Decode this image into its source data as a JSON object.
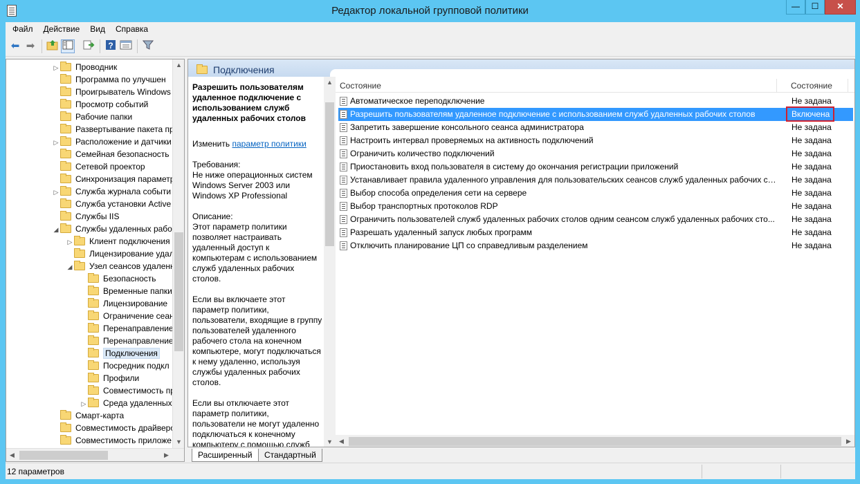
{
  "window": {
    "title": "Редактор локальной групповой политики",
    "controls": [
      "—",
      "☐",
      "✕"
    ]
  },
  "menu": [
    {
      "label": "Файл"
    },
    {
      "label": "Действие"
    },
    {
      "label": "Вид"
    },
    {
      "label": "Справка"
    }
  ],
  "tree": {
    "items": [
      {
        "label": "Проводник",
        "level": 0,
        "arrow": "▷"
      },
      {
        "label": "Программа по улучшен",
        "level": 0,
        "arrow": ""
      },
      {
        "label": "Проигрыватель Windows",
        "level": 0,
        "arrow": ""
      },
      {
        "label": "Просмотр событий",
        "level": 0,
        "arrow": ""
      },
      {
        "label": "Рабочие папки",
        "level": 0,
        "arrow": ""
      },
      {
        "label": "Развертывание пакета пр",
        "level": 0,
        "arrow": ""
      },
      {
        "label": "Расположение и датчики",
        "level": 0,
        "arrow": "▷"
      },
      {
        "label": "Семейная безопасность",
        "level": 0,
        "arrow": ""
      },
      {
        "label": "Сетевой проектор",
        "level": 0,
        "arrow": ""
      },
      {
        "label": "Синхронизация параметр",
        "level": 0,
        "arrow": ""
      },
      {
        "label": "Служба журнала событи",
        "level": 0,
        "arrow": "▷"
      },
      {
        "label": "Служба установки Active",
        "level": 0,
        "arrow": ""
      },
      {
        "label": "Службы IIS",
        "level": 0,
        "arrow": ""
      },
      {
        "label": "Службы удаленных рабо",
        "level": 0,
        "arrow": "◢"
      },
      {
        "label": "Клиент подключения",
        "level": 1,
        "arrow": "▷"
      },
      {
        "label": "Лицензирование удал",
        "level": 1,
        "arrow": ""
      },
      {
        "label": "Узел сеансов удаленн",
        "level": 1,
        "arrow": "◢"
      },
      {
        "label": "Безопасность",
        "level": 2,
        "arrow": ""
      },
      {
        "label": "Временные папки",
        "level": 2,
        "arrow": ""
      },
      {
        "label": "Лицензирование",
        "level": 2,
        "arrow": ""
      },
      {
        "label": "Ограничение сеан",
        "level": 2,
        "arrow": ""
      },
      {
        "label": "Перенаправление",
        "level": 2,
        "arrow": ""
      },
      {
        "label": "Перенаправление",
        "level": 2,
        "arrow": ""
      },
      {
        "label": "Подключения",
        "level": 2,
        "arrow": "",
        "selected": true
      },
      {
        "label": "Посредник подкл",
        "level": 2,
        "arrow": ""
      },
      {
        "label": "Профили",
        "level": 2,
        "arrow": ""
      },
      {
        "label": "Совместимость пр",
        "level": 2,
        "arrow": ""
      },
      {
        "label": "Среда удаленных с",
        "level": 2,
        "arrow": "▷"
      },
      {
        "label": "Смарт-карта",
        "level": 0,
        "arrow": ""
      },
      {
        "label": "Совместимость драйверо",
        "level": 0,
        "arrow": ""
      },
      {
        "label": "Совместимость приложе",
        "level": 0,
        "arrow": ""
      }
    ]
  },
  "header": {
    "title": "Подключения"
  },
  "description": {
    "title": "Разрешить пользователям удаленное подключение с использованием служб удаленных рабочих столов",
    "edit_prefix": "Изменить",
    "edit_link": "параметр политики",
    "requirements": "Требования:\nНе ниже операционных систем Windows Server 2003 или Windows XP Professional",
    "desc1": "Описание:\nЭтот параметр политики позволяет настраивать удаленный доступ к компьютерам с использованием служб удаленных рабочих столов.",
    "desc2": "Если вы включаете этот параметр политики, пользователи, входящие в группу пользователей удаленного рабочего стола на конечном компьютере, могут подключаться к нему удаленно, используя службы удаленных рабочих столов.",
    "desc3": "Если вы отключаете этот параметр политики, пользователи не могут удаленно подключаться к конечному компьютеру с помощью служб"
  },
  "list": {
    "columns": {
      "name": "Состояние",
      "state": "Состояние"
    },
    "rows": [
      {
        "name": "Автоматическое переподключение",
        "state": "Не задана"
      },
      {
        "name": "Разрешить пользователям удаленное подключение с использованием служб удаленных рабочих столов",
        "state": "Включена",
        "selected": true
      },
      {
        "name": "Запретить завершение консольного сеанса администратора",
        "state": "Не задана"
      },
      {
        "name": "Настроить интервал проверяемых на активность подключений",
        "state": "Не задана"
      },
      {
        "name": "Ограничить количество подключений",
        "state": "Не задана"
      },
      {
        "name": "Приостановить вход пользователя в систему до окончания регистрации приложений",
        "state": "Не задана"
      },
      {
        "name": "Устанавливает правила удаленного управления для пользовательских сеансов служб удаленных рабочих сто...",
        "state": "Не задана"
      },
      {
        "name": "Выбор способа определения сети на сервере",
        "state": "Не задана"
      },
      {
        "name": "Выбор транспортных протоколов RDP",
        "state": "Не задана"
      },
      {
        "name": "Ограничить пользователей служб удаленных рабочих столов одним сеансом служб удаленных рабочих сто...",
        "state": "Не задана"
      },
      {
        "name": "Разрешать удаленный запуск любых программ",
        "state": "Не задана"
      },
      {
        "name": "Отключить планирование ЦП со справедливым разделением",
        "state": "Не задана"
      }
    ]
  },
  "tabs": [
    {
      "label": "Расширенный",
      "active": true
    },
    {
      "label": "Стандартный",
      "active": false
    }
  ],
  "status": {
    "text": "12 параметров"
  },
  "colors": {
    "title_bar": "#5cc6f2",
    "selection": "#3399ff",
    "highlight_box": "#d0202f",
    "link": "#0563c1"
  }
}
